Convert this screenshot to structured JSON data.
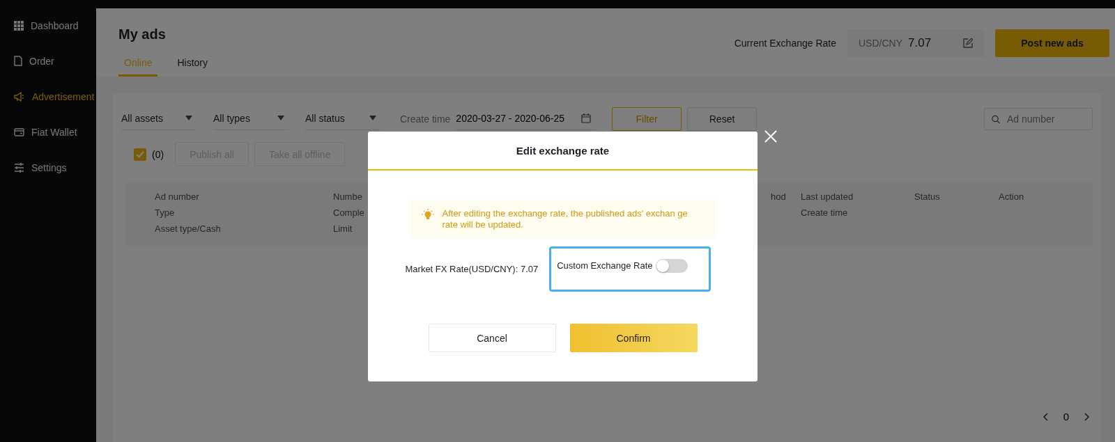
{
  "sidebar": {
    "items": [
      {
        "label": "Dashboard",
        "selected": false
      },
      {
        "label": "Order",
        "selected": false
      },
      {
        "label": "Advertisement",
        "selected": true
      },
      {
        "label": "Fiat Wallet",
        "selected": false
      },
      {
        "label": "Settings",
        "selected": false
      }
    ]
  },
  "header": {
    "title": "My ads",
    "tabs": [
      {
        "label": "Online",
        "selected": true
      },
      {
        "label": "History",
        "selected": false
      }
    ],
    "rate_label": "Current Exchange Rate",
    "rate_pair": "USD/CNY",
    "rate_value": "7.07",
    "post_button": "Post new ads"
  },
  "filters": {
    "dropdowns": [
      "All assets",
      "All types",
      "All status"
    ],
    "create_time_label": "Create time",
    "date_range": "2020-03-27 - 2020-06-25",
    "filter_button": "Filter",
    "reset_button": "Reset",
    "search": {
      "placeholder": "Ad number"
    }
  },
  "bulk": {
    "checked": true,
    "count": "(0)",
    "buttons": [
      "Publish all",
      "Take all offline"
    ]
  },
  "table": {
    "columns": [
      [
        "Ad number",
        "Type",
        "Asset type/Cash"
      ],
      [
        "Numbe",
        "Comple",
        "Limit"
      ],
      [
        "hod"
      ],
      [
        "Last updated",
        "Create time"
      ],
      [
        "Status"
      ],
      [
        "Action"
      ]
    ]
  },
  "pagination": {
    "page": "0"
  },
  "dialog": {
    "title": "Edit exchange rate",
    "notice": "After editing the exchange rate, the published ads' exchan ge rate will be updated.",
    "market_rate": "Market FX Rate(USD/CNY): 7.07",
    "custom_label": "Custom Exchange Rate",
    "custom_on": false,
    "cancel": "Cancel",
    "confirm": "Confirm"
  }
}
